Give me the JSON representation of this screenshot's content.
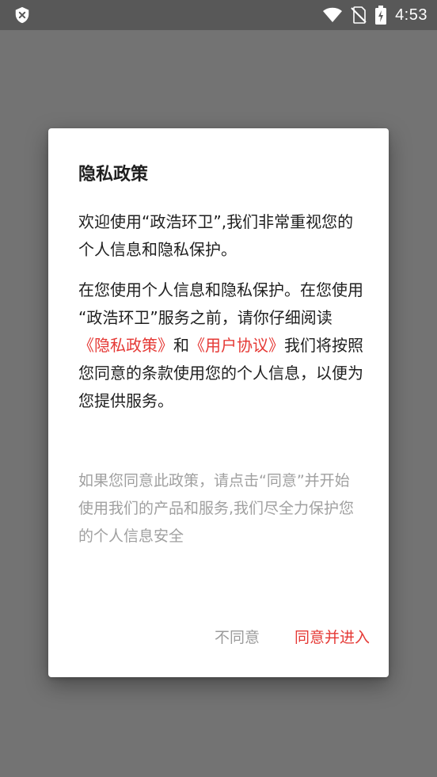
{
  "status_bar": {
    "time": "4:53",
    "left_icon": "shield-x-icon",
    "icons": [
      "wifi-icon",
      "no-sim-icon",
      "battery-charging-icon"
    ]
  },
  "dialog": {
    "title": "隐私政策",
    "intro": "欢迎使用“政浩环卫”,我们非常重视您的个人信息和隐私保护。",
    "p2_line1": "在您使用个人信息和隐私保护。在您使用",
    "p2_line2_prefix": "“政浩环卫”服务之前，请你仔细阅读",
    "privacy_link": "《隐私政策》",
    "and": "和",
    "user_agreement_link": "《用户协议》",
    "p2_suffix": "我们将按照您同意的条款使用您的个人信息，以便为您提供服务。",
    "hint": "如果您同意此政策，请点击“同意”并开始使用我们的产品和服务,我们尽全力保护您的个人信息安全",
    "disagree_label": "不同意",
    "agree_label": "同意并进入"
  },
  "colors": {
    "accent": "#e53935",
    "scrim": "#737373",
    "status_bar": "#585858",
    "hint_text": "#a0a0a0"
  }
}
